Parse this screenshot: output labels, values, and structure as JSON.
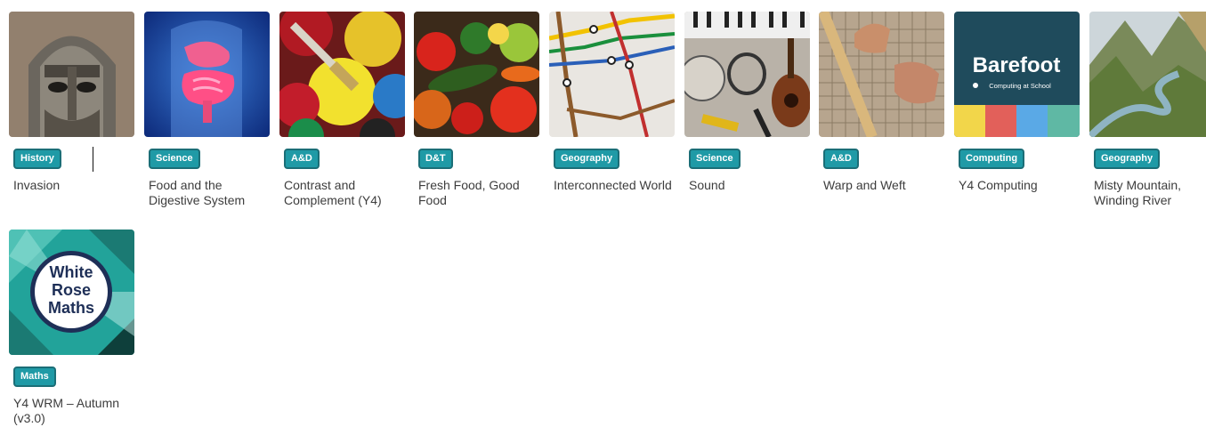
{
  "cards": [
    {
      "subject": "History",
      "title": "Invasion",
      "thumb_icon": "helmet-image"
    },
    {
      "subject": "Science",
      "title": "Food and the Digestive System",
      "thumb_icon": "digestive-system-image"
    },
    {
      "subject": "A&D",
      "title": "Contrast and Complement (Y4)",
      "thumb_icon": "paint-pots-image"
    },
    {
      "subject": "D&T",
      "title": "Fresh Food, Good Food",
      "thumb_icon": "vegetables-image"
    },
    {
      "subject": "Geography",
      "title": "Interconnected World",
      "thumb_icon": "transit-map-image"
    },
    {
      "subject": "Science",
      "title": "Sound",
      "thumb_icon": "instruments-image"
    },
    {
      "subject": "A&D",
      "title": "Warp and Weft",
      "thumb_icon": "weaving-image"
    },
    {
      "subject": "Computing",
      "title": "Y4 Computing",
      "thumb_icon": "barefoot-logo",
      "logo_text": "Barefoot",
      "logo_subtext": "Computing at School"
    },
    {
      "subject": "Geography",
      "title": "Misty Mountain, Winding River",
      "thumb_icon": "mountain-river-image"
    },
    {
      "subject": "Maths",
      "title": "Y4 WRM – Autumn (v3.0)",
      "thumb_icon": "white-rose-maths-logo",
      "logo_lines": [
        "White",
        "Rose",
        "Maths"
      ]
    }
  ],
  "colors": {
    "badge_bg": "#1f9aa6",
    "badge_border": "#1b6e77",
    "title_text": "#3d3d3d"
  }
}
